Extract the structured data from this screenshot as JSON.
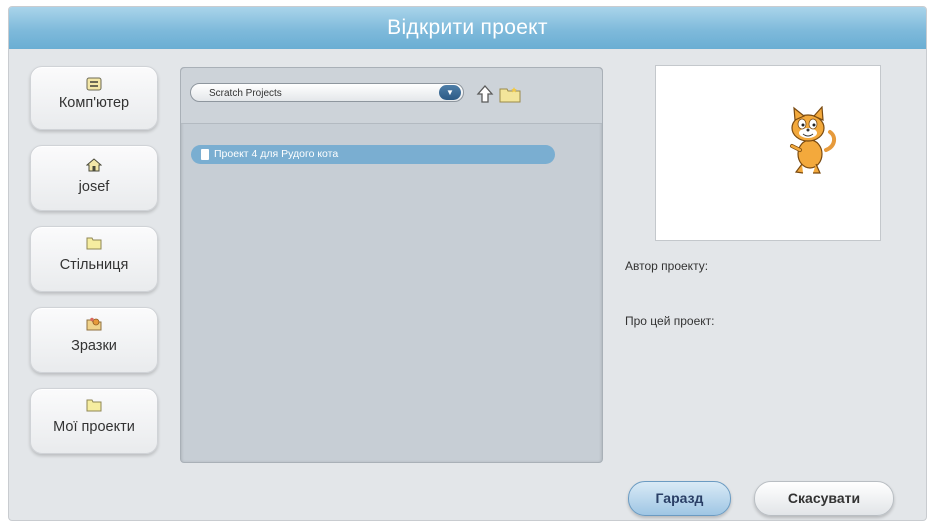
{
  "dialog": {
    "title": "Відкрити проект"
  },
  "locations": [
    {
      "label": "Комп'ютер",
      "icon": "computer-icon"
    },
    {
      "label": "josef",
      "icon": "home-icon"
    },
    {
      "label": "Стільниця",
      "icon": "folder-icon"
    },
    {
      "label": "Зразки",
      "icon": "samples-icon"
    },
    {
      "label": "Мої проекти",
      "icon": "folder-icon"
    }
  ],
  "browser": {
    "current_folder": "Scratch Projects",
    "up_icon": "up-arrow-icon",
    "new_folder_icon": "new-folder-icon",
    "files": [
      {
        "name": "Проект 4 для Рудого кота",
        "selected": true
      }
    ]
  },
  "info": {
    "author_label": "Автор проекту:",
    "about_label": "Про цей проект:"
  },
  "buttons": {
    "ok": "Гаразд",
    "cancel": "Скасувати"
  },
  "colors": {
    "title_bar": "#7fbadb",
    "selection": "#7aaed1",
    "ok_button": "#9fc6e4"
  }
}
